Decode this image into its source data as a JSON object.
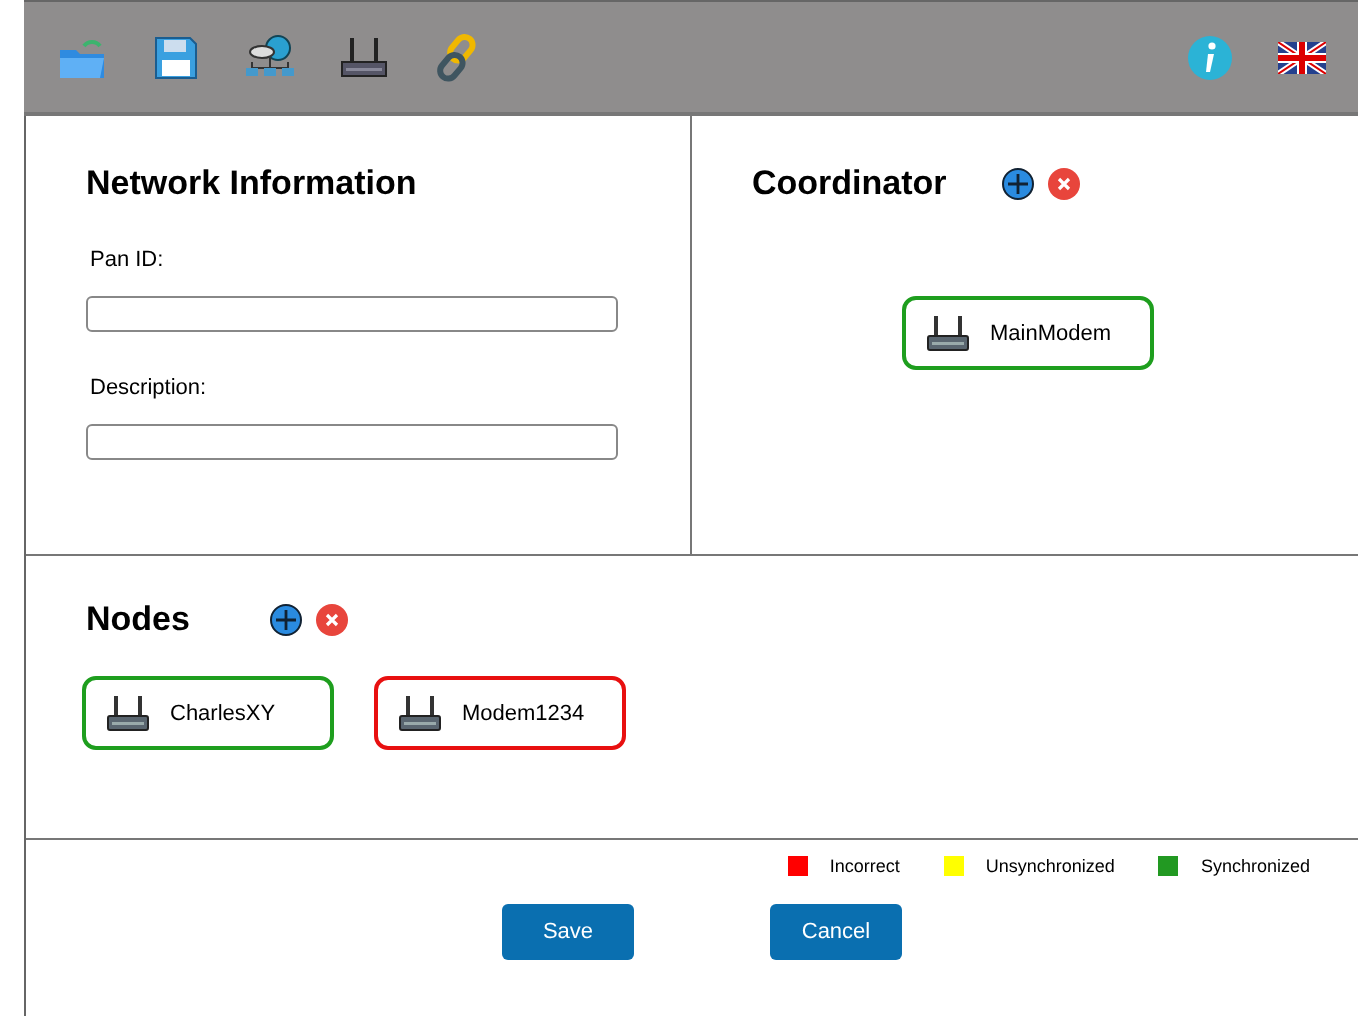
{
  "network_information": {
    "title": "Network Information",
    "fields": [
      {
        "label": "Pan ID:"
      },
      {
        "label": "Description:"
      }
    ]
  },
  "coordinator": {
    "title": "Coordinator",
    "devices": [
      {
        "name": "MainModem",
        "color": "#1e9e1e"
      }
    ]
  },
  "nodes": {
    "title": "Nodes",
    "devices": [
      {
        "name": "CharlesXY",
        "color": "#1e9e1e"
      },
      {
        "name": "Modem1234",
        "color": "#e81010"
      }
    ]
  },
  "legend": [
    {
      "label": "Incorrect",
      "color": "#ff0000"
    },
    {
      "label": "Unsynchronized",
      "color": "#ffff00"
    },
    {
      "label": "Synchronized",
      "color": "#229922"
    }
  ],
  "buttons": [
    "Save",
    "Cancel"
  ]
}
